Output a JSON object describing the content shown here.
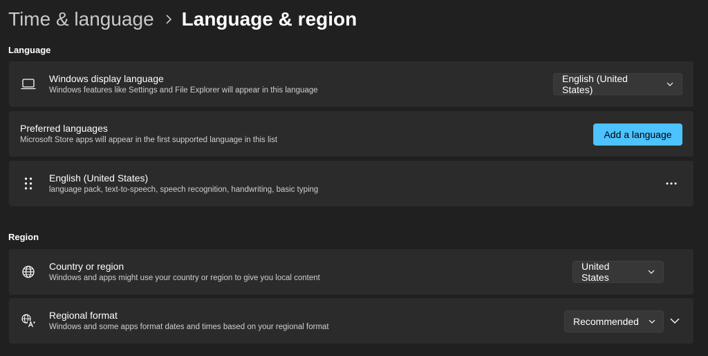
{
  "breadcrumb": {
    "parent": "Time & language",
    "current": "Language & region"
  },
  "sections": {
    "language_title": "Language",
    "region_title": "Region"
  },
  "display_language": {
    "title": "Windows display language",
    "subtitle": "Windows features like Settings and File Explorer will appear in this language",
    "icon": "laptop-icon",
    "selected": "English (United States)"
  },
  "preferred_languages": {
    "title": "Preferred languages",
    "subtitle": "Microsoft Store apps will appear in the first supported language in this list",
    "button_label": "Add a language"
  },
  "installed_language": {
    "title": "English (United States)",
    "subtitle": "language pack, text-to-speech, speech recognition, handwriting, basic typing",
    "icon": "drag-handle-icon",
    "more_label": "···"
  },
  "country": {
    "title": "Country or region",
    "subtitle": "Windows and apps might use your country or region to give you local content",
    "icon": "globe-icon",
    "selected": "United States"
  },
  "regional_format": {
    "title": "Regional format",
    "subtitle": "Windows and some apps format dates and times based on your regional format",
    "icon": "regional-format-icon",
    "selected": "Recommended"
  },
  "colors": {
    "background": "#202020",
    "card": "#2b2b2b",
    "accent": "#4cc2ff"
  }
}
